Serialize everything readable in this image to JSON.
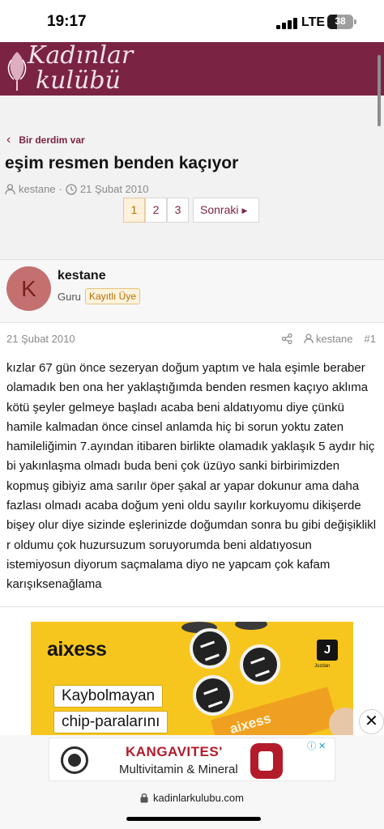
{
  "status_bar": {
    "time": "19:17",
    "network": "LTE",
    "battery": "38",
    "battery_level": 0.38
  },
  "header": {
    "logo_line1": "Kadınlar",
    "logo_line2": "kulübü",
    "brand_color": "#7b2343"
  },
  "breadcrumb": {
    "label": "Bir derdim var"
  },
  "thread": {
    "title": "eşim resmen benden kaçıyor",
    "author": "kestane",
    "separator": "·",
    "date": "21 Şubat 2010"
  },
  "pagination": {
    "pages": [
      "1",
      "2",
      "3"
    ],
    "current": "1",
    "next_label": "Sonraki"
  },
  "post": {
    "avatar_letter": "K",
    "username": "kestane",
    "user_title": "Guru",
    "user_badge": "Kayıtlı Üye",
    "date": "21 Şubat 2010",
    "author": "kestane",
    "post_number": "#1",
    "body": "kızlar 67 gün önce sezeryan doğum yaptım ve hala eşimle beraber olamadık ben ona her yaklaştığımda benden resmen kaçıyo aklıma kötü şeyler gelmeye başladı acaba beni aldatıyomu diye çünkü hamile kalmadan önce cinsel anlamda hiç bi sorun yoktu zaten hamileliğimin 7.ayından itibaren birlikte olamadık yaklaşık 5 aydır hiç bi yakınlaşma olmadı buda beni çok üzüyo sanki birbirimizden kopmuş gibiyiz ama sarılır öper şakal ar yapar dokunur ama daha fazlası olmadı acaba doğum yeni oldu sayılır korkuyomu dikişerde bişey olur diye sizinde eşlerinizde doğumdan sonra bu gibi değişiklikl r oldumu çok huzursuzum soruyorumda beni aldatıyosun istemiyosun diyorum saçmalama diyo ne yapcam çok kafam karışıksenağlama"
  },
  "ad": {
    "brand": "aixess",
    "logo_letter": "J",
    "logo_caption": "Juzdan",
    "line1": "Kaybolmayan",
    "line2": "chip-paralarını",
    "box_text": "aixess",
    "close_label": "✕",
    "bg_color": "#f7c61e"
  },
  "banner": {
    "title": "KANGAVITES'",
    "subtitle": "Multivitamin & Mineral",
    "ad_icons": "ⓘ ✕"
  },
  "address_bar": {
    "url": "kadinlarkulubu.com"
  }
}
